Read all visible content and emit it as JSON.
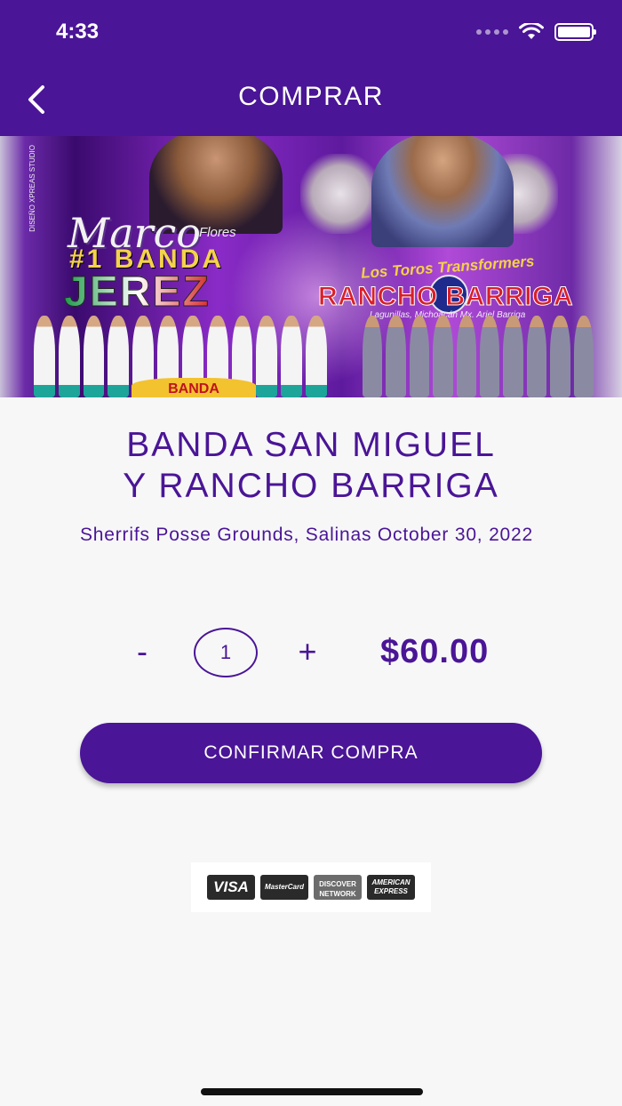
{
  "status_bar": {
    "time": "4:33"
  },
  "nav": {
    "title": "COMPRAR",
    "back_icon": "chevron-left-icon"
  },
  "banner": {
    "credit": "DISEÑO XPREAS STUDIO",
    "text_marco": "Marco",
    "text_flores": "Flores",
    "text_banda": "#1 BANDA",
    "text_jerez": "JEREZ",
    "text_transformers": "Los Toros Transformers",
    "text_rancho": "RANCHO BARRIGA",
    "text_sub": "Lagunillas, Michoacán Mx.  Ariel Barriga",
    "text_yellow": "BANDA"
  },
  "event": {
    "title_line1": "BANDA SAN MIGUEL",
    "title_line2": "Y RANCHO BARRIGA",
    "meta": "Sherrifs Posse Grounds, Salinas   October 30, 2022"
  },
  "purchase": {
    "minus_label": "-",
    "quantity": "1",
    "plus_label": "+",
    "price": "$60.00",
    "confirm_label": "CONFIRMAR COMPRA"
  },
  "payment_cards": [
    {
      "label": "VISA"
    },
    {
      "label": "MasterCard"
    },
    {
      "label": "DISCOVER NETWORK"
    },
    {
      "label": "AMERICAN EXPRESS"
    }
  ],
  "colors": {
    "brand_purple": "#4a1596",
    "background": "#f7f7f8"
  }
}
